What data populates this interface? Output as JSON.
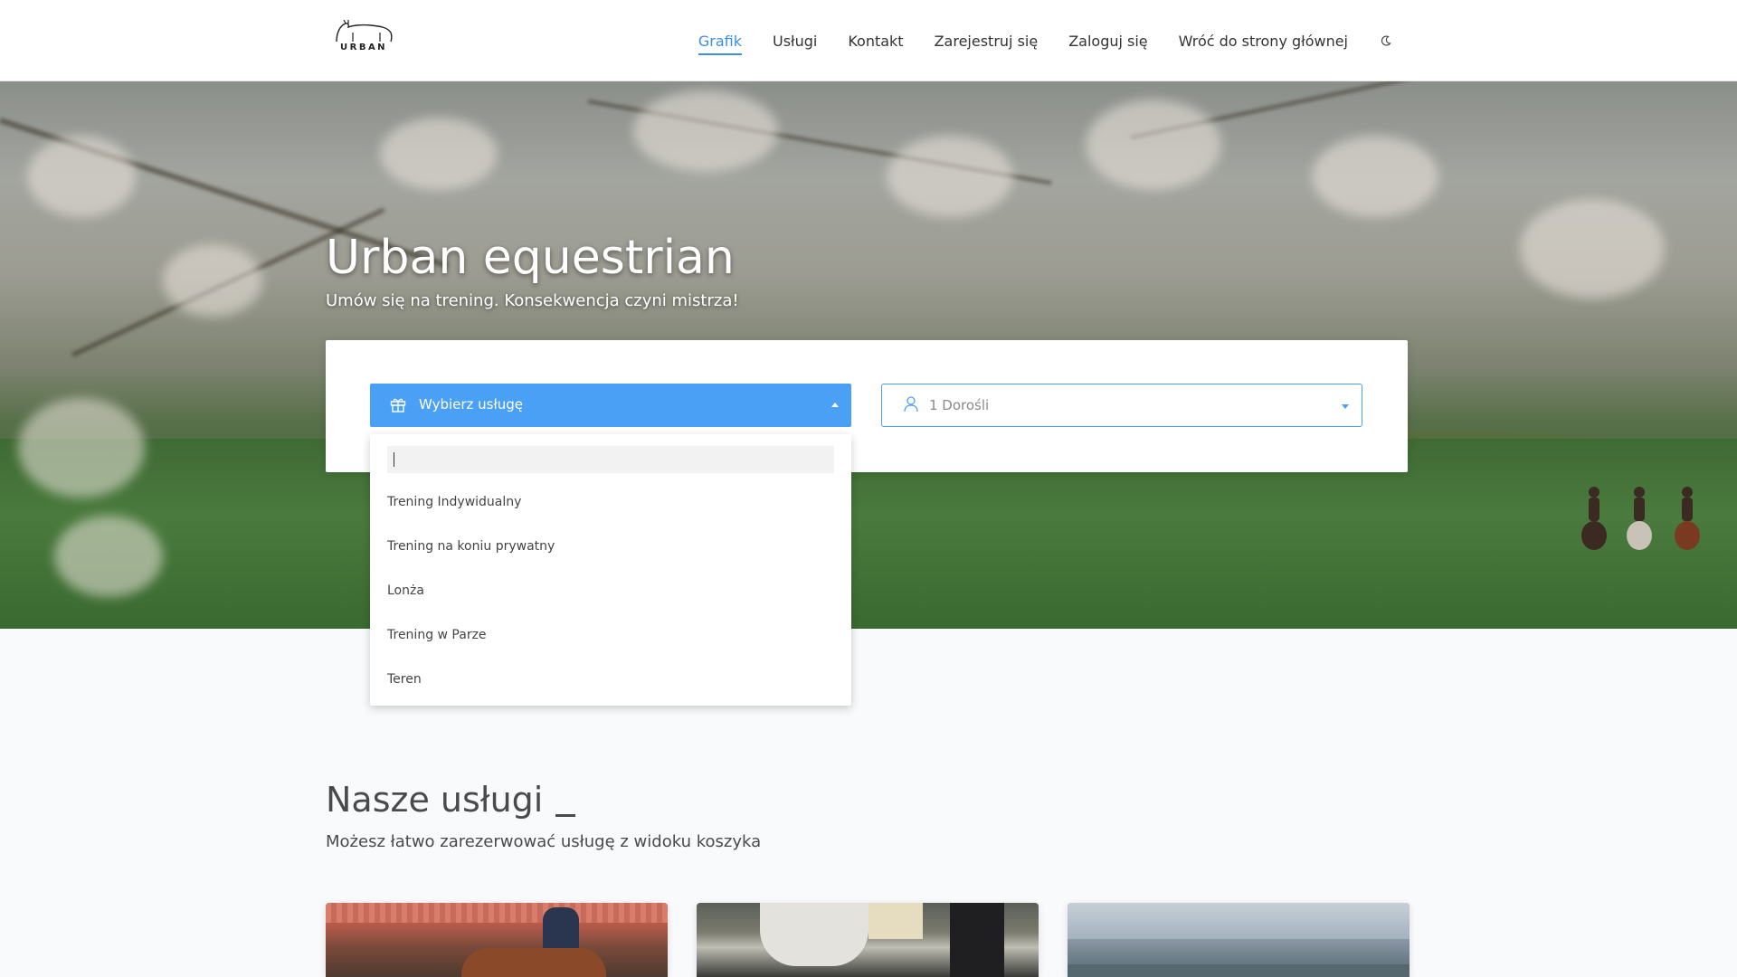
{
  "header": {
    "logo_text": "URBAN",
    "nav": [
      {
        "label": "Grafik",
        "active": true
      },
      {
        "label": "Usługi",
        "active": false
      },
      {
        "label": "Kontakt",
        "active": false
      },
      {
        "label": "Zarejestruj się",
        "active": false
      },
      {
        "label": "Zaloguj się",
        "active": false
      },
      {
        "label": "Wróć do strony głównej",
        "active": false
      }
    ],
    "theme_toggle_icon": "moon-icon"
  },
  "hero": {
    "title": "Urban equestrian",
    "subtitle": "Umów się na trening. Konsekwencja czyni mistrza!"
  },
  "booking": {
    "service_select": {
      "label": "Wybierz usługę",
      "icon": "gift-icon",
      "open": true
    },
    "people_select": {
      "label": "1 Dorośli",
      "icon": "person-icon"
    },
    "dropdown": {
      "search_value": "",
      "options": [
        "Trening Indywidualny",
        "Trening na koniu prywatny",
        "Lonża",
        "Trening w Parze",
        "Teren"
      ]
    }
  },
  "services": {
    "title": "Nasze usługi",
    "subtitle": "Możesz łatwo zarezerwować usługę z widoku koszyka",
    "cards_count_visible": 3
  },
  "colors": {
    "accent": "#3a8fe8",
    "select_bg": "#4aa0f5",
    "text_dark": "#333333"
  }
}
